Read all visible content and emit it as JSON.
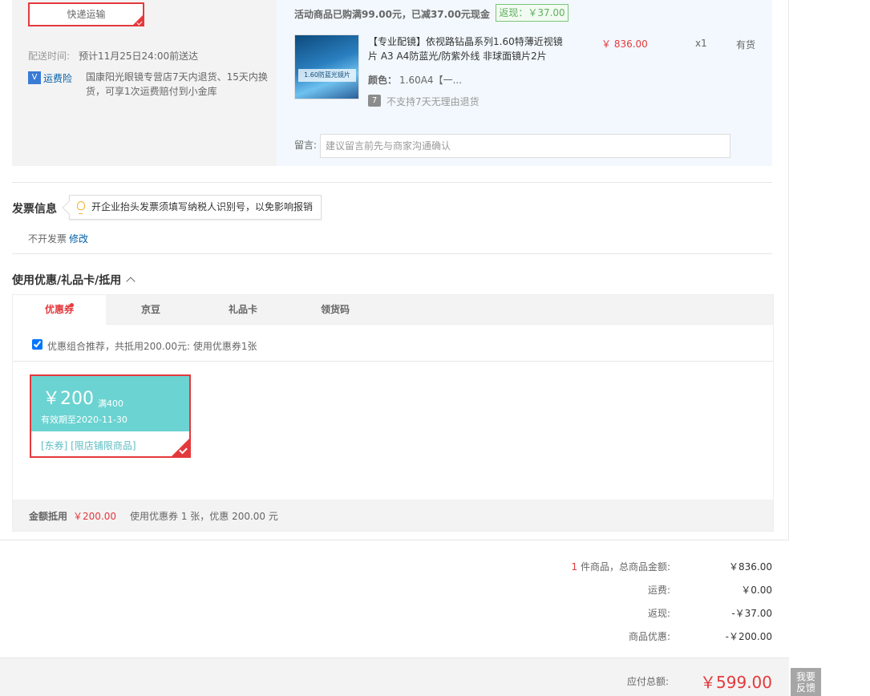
{
  "shipping": {
    "method": "快递运输",
    "delivery_label": "配送时间:",
    "delivery_time": "预计11月25日24:00前送达",
    "insurance_icon": "V",
    "insurance_label": "运费险",
    "insurance_desc": "国康阳光眼镜专营店7天内退货、15天内换货，可享1次运费赔付到小金库"
  },
  "shop": {
    "promo_text": "活动商品已购满99.00元，已减37.00元现金",
    "rebate_tag": "返现：￥37.00",
    "product": {
      "image_caption": "1.60防蓝光镜片",
      "name": "【专业配镜】依视路钻晶系列1.60特薄近视镜片 A3 A4防蓝光/防紫外线 非球面镜片2片",
      "price": "￥ 836.00",
      "qty": "x1",
      "stock": "有货",
      "color_label": "颜色：",
      "color_value": "1.60A4【一...",
      "no_return_icon": "7",
      "no_return_text": "不支持7天无理由退货"
    },
    "message_label": "留言:",
    "message_placeholder": "建议留言前先与商家沟通确认"
  },
  "invoice": {
    "title": "发票信息",
    "tip": "开企业抬头发票须填写纳税人识别号，以免影响报销",
    "status": "不开发票",
    "edit": "修改"
  },
  "coupons": {
    "title": "使用优惠/礼品卡/抵用",
    "tabs": [
      {
        "label": "优惠券"
      },
      {
        "label": "京豆"
      },
      {
        "label": "礼品卡"
      },
      {
        "label": "领货码"
      }
    ],
    "combo_text": "优惠组合推荐，共抵用200.00元: 使用优惠券1张",
    "coupon": {
      "amount": "￥200",
      "condition": "满400",
      "expiry": "有效期至2020-11-30",
      "tags": "[东券] [限店铺限商品]"
    },
    "summary_label": "金额抵用",
    "summary_value": "￥200.00",
    "summary_desc": "使用优惠券 1 张，优惠 200.00 元"
  },
  "totals": {
    "count": "1",
    "count_suffix": " 件商品，总商品金额:",
    "goods_amount": "￥836.00",
    "shipping_label": "运费:",
    "shipping_value": "￥0.00",
    "rebate_label": "返现:",
    "rebate_value": "-￥37.00",
    "discount_label": "商品优惠:",
    "discount_value": "-￥200.00",
    "pay_label": "应付总额:",
    "pay_value": "￥599.00"
  },
  "feedback": {
    "line1": "我要",
    "line2": "反馈"
  },
  "colors": {
    "accent": "#e4393c",
    "link": "#005ea7",
    "coupon": "#6bd3d1"
  }
}
